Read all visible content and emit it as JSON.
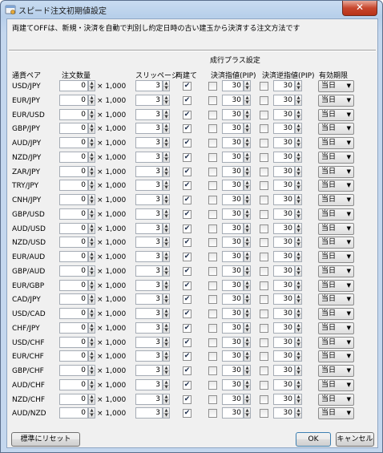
{
  "window": {
    "title": "スピード注文初期値設定",
    "close_label": "✕",
    "description": "両建てOFFは、新規・決済を自動で判別し約定日時の古い建玉から決済する注文方法です"
  },
  "headers": {
    "pair": "通貨ペア",
    "quantity": "注文数量",
    "slippage": "スリッページ",
    "hedge": "両建て",
    "group": "成行プラス設定",
    "limit": "決済指値(PIP)",
    "stop": "決済逆指値(PIP)",
    "expiry": "有効期限"
  },
  "rows": [
    {
      "pair": "USD/JPY",
      "qty": "0",
      "mult": "× 1,000",
      "slip": "3",
      "hedge": true,
      "limit_on": false,
      "limit": "30",
      "stop_on": false,
      "stop": "30",
      "expiry": "当日"
    },
    {
      "pair": "EUR/JPY",
      "qty": "0",
      "mult": "× 1,000",
      "slip": "3",
      "hedge": true,
      "limit_on": false,
      "limit": "30",
      "stop_on": false,
      "stop": "30",
      "expiry": "当日"
    },
    {
      "pair": "EUR/USD",
      "qty": "0",
      "mult": "× 1,000",
      "slip": "3",
      "hedge": true,
      "limit_on": false,
      "limit": "30",
      "stop_on": false,
      "stop": "30",
      "expiry": "当日"
    },
    {
      "pair": "GBP/JPY",
      "qty": "0",
      "mult": "× 1,000",
      "slip": "3",
      "hedge": true,
      "limit_on": false,
      "limit": "30",
      "stop_on": false,
      "stop": "30",
      "expiry": "当日"
    },
    {
      "pair": "AUD/JPY",
      "qty": "0",
      "mult": "× 1,000",
      "slip": "3",
      "hedge": true,
      "limit_on": false,
      "limit": "30",
      "stop_on": false,
      "stop": "30",
      "expiry": "当日"
    },
    {
      "pair": "NZD/JPY",
      "qty": "0",
      "mult": "× 1,000",
      "slip": "3",
      "hedge": true,
      "limit_on": false,
      "limit": "30",
      "stop_on": false,
      "stop": "30",
      "expiry": "当日"
    },
    {
      "pair": "ZAR/JPY",
      "qty": "0",
      "mult": "× 1,000",
      "slip": "3",
      "hedge": true,
      "limit_on": false,
      "limit": "30",
      "stop_on": false,
      "stop": "30",
      "expiry": "当日"
    },
    {
      "pair": "TRY/JPY",
      "qty": "0",
      "mult": "× 1,000",
      "slip": "3",
      "hedge": true,
      "limit_on": false,
      "limit": "30",
      "stop_on": false,
      "stop": "30",
      "expiry": "当日"
    },
    {
      "pair": "CNH/JPY",
      "qty": "0",
      "mult": "× 1,000",
      "slip": "3",
      "hedge": true,
      "limit_on": false,
      "limit": "30",
      "stop_on": false,
      "stop": "30",
      "expiry": "当日"
    },
    {
      "pair": "GBP/USD",
      "qty": "0",
      "mult": "× 1,000",
      "slip": "3",
      "hedge": true,
      "limit_on": false,
      "limit": "30",
      "stop_on": false,
      "stop": "30",
      "expiry": "当日"
    },
    {
      "pair": "AUD/USD",
      "qty": "0",
      "mult": "× 1,000",
      "slip": "3",
      "hedge": true,
      "limit_on": false,
      "limit": "30",
      "stop_on": false,
      "stop": "30",
      "expiry": "当日"
    },
    {
      "pair": "NZD/USD",
      "qty": "0",
      "mult": "× 1,000",
      "slip": "3",
      "hedge": true,
      "limit_on": false,
      "limit": "30",
      "stop_on": false,
      "stop": "30",
      "expiry": "当日"
    },
    {
      "pair": "EUR/AUD",
      "qty": "0",
      "mult": "× 1,000",
      "slip": "3",
      "hedge": true,
      "limit_on": false,
      "limit": "30",
      "stop_on": false,
      "stop": "30",
      "expiry": "当日"
    },
    {
      "pair": "GBP/AUD",
      "qty": "0",
      "mult": "× 1,000",
      "slip": "3",
      "hedge": true,
      "limit_on": false,
      "limit": "30",
      "stop_on": false,
      "stop": "30",
      "expiry": "当日"
    },
    {
      "pair": "EUR/GBP",
      "qty": "0",
      "mult": "× 1,000",
      "slip": "3",
      "hedge": true,
      "limit_on": false,
      "limit": "30",
      "stop_on": false,
      "stop": "30",
      "expiry": "当日"
    },
    {
      "pair": "CAD/JPY",
      "qty": "0",
      "mult": "× 1,000",
      "slip": "3",
      "hedge": true,
      "limit_on": false,
      "limit": "30",
      "stop_on": false,
      "stop": "30",
      "expiry": "当日"
    },
    {
      "pair": "USD/CAD",
      "qty": "0",
      "mult": "× 1,000",
      "slip": "3",
      "hedge": true,
      "limit_on": false,
      "limit": "30",
      "stop_on": false,
      "stop": "30",
      "expiry": "当日"
    },
    {
      "pair": "CHF/JPY",
      "qty": "0",
      "mult": "× 1,000",
      "slip": "3",
      "hedge": true,
      "limit_on": false,
      "limit": "30",
      "stop_on": false,
      "stop": "30",
      "expiry": "当日"
    },
    {
      "pair": "USD/CHF",
      "qty": "0",
      "mult": "× 1,000",
      "slip": "3",
      "hedge": true,
      "limit_on": false,
      "limit": "30",
      "stop_on": false,
      "stop": "30",
      "expiry": "当日"
    },
    {
      "pair": "EUR/CHF",
      "qty": "0",
      "mult": "× 1,000",
      "slip": "3",
      "hedge": true,
      "limit_on": false,
      "limit": "30",
      "stop_on": false,
      "stop": "30",
      "expiry": "当日"
    },
    {
      "pair": "GBP/CHF",
      "qty": "0",
      "mult": "× 1,000",
      "slip": "3",
      "hedge": true,
      "limit_on": false,
      "limit": "30",
      "stop_on": false,
      "stop": "30",
      "expiry": "当日"
    },
    {
      "pair": "AUD/CHF",
      "qty": "0",
      "mult": "× 1,000",
      "slip": "3",
      "hedge": true,
      "limit_on": false,
      "limit": "30",
      "stop_on": false,
      "stop": "30",
      "expiry": "当日"
    },
    {
      "pair": "NZD/CHF",
      "qty": "0",
      "mult": "× 1,000",
      "slip": "3",
      "hedge": true,
      "limit_on": false,
      "limit": "30",
      "stop_on": false,
      "stop": "30",
      "expiry": "当日"
    },
    {
      "pair": "AUD/NZD",
      "qty": "0",
      "mult": "× 1,000",
      "slip": "3",
      "hedge": true,
      "limit_on": false,
      "limit": "30",
      "stop_on": false,
      "stop": "30",
      "expiry": "当日"
    }
  ],
  "footer": {
    "reset_label": "標準にリセット",
    "ok_label": "OK",
    "cancel_label": "キャンセル"
  },
  "icons": {
    "title": "gear-window-icon",
    "check": "checkmark-icon",
    "dropdown": "chevron-down-icon",
    "spin_up": "spin-up-arrow-icon",
    "spin_down": "spin-down-arrow-icon"
  },
  "colors": {
    "title_bar": "#b7cfea",
    "client": "#f0f0f0",
    "close_button": "#c7462d"
  }
}
